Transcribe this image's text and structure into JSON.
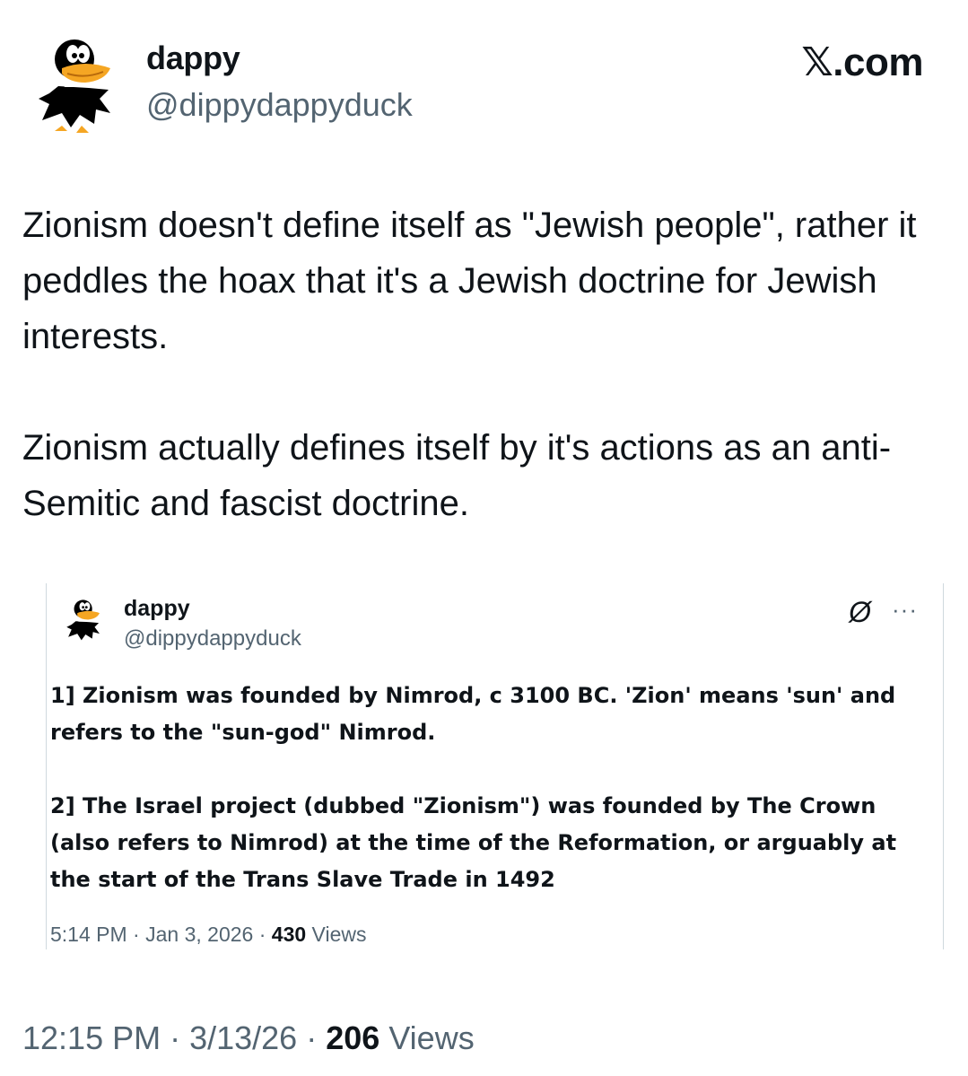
{
  "app": {
    "brand": "𝕏.com"
  },
  "author": {
    "display_name": "dappy",
    "handle": "@dippydappyduck",
    "avatar_icon": "daffy-duck-avatar"
  },
  "tweet": {
    "paragraphs": [
      "Zionism doesn't define itself as \"Jewish people\", rather it peddles the hoax that it's a Jewish doctrine for Jewish interests.",
      "Zionism actually defines itself by it's actions as an anti-Semitic and fascist doctrine."
    ],
    "time": "12:15 PM",
    "date": "3/13/26",
    "views_count": "206",
    "views_label": "Views"
  },
  "quoted": {
    "display_name": "dappy",
    "handle": "@dippydappyduck",
    "grok_icon": "grok-icon",
    "grok_glyph": "Ø",
    "more_glyph": "···",
    "paragraphs": [
      "1] Zionism was founded by Nimrod, c 3100 BC. 'Zion' means 'sun' and refers to the \"sun-god\" Nimrod.",
      "2] The Israel project (dubbed \"Zionism\") was founded by The Crown (also refers to Nimrod) at the time of the Reformation, or arguably at the start of the Trans Slave Trade in 1492"
    ],
    "time": "5:14 PM",
    "date": "Jan 3, 2026",
    "views_count": "430",
    "views_label": "Views"
  },
  "separator": " · ",
  "colors": {
    "text": "#0f1419",
    "secondary": "#536471",
    "border": "#cfd9de",
    "duck_black": "#000000",
    "duck_beak": "#f5a623"
  }
}
